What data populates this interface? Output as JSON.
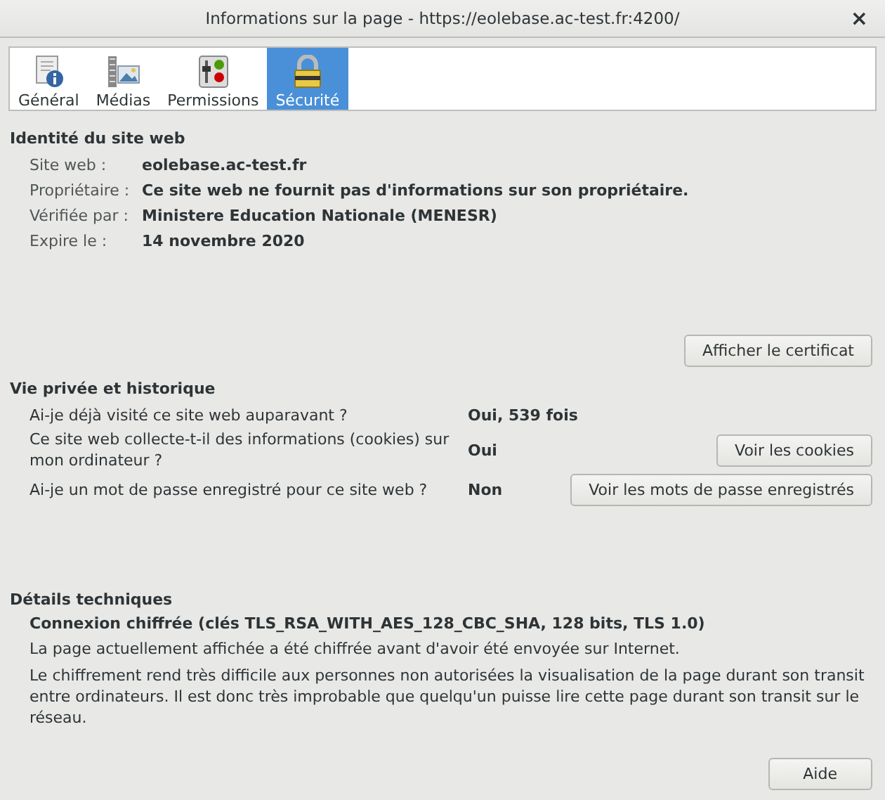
{
  "window": {
    "title": "Informations sur la page - https://eolebase.ac-test.fr:4200/",
    "close": "×"
  },
  "tabs": [
    {
      "label": "Général",
      "kind": "general",
      "selected": false
    },
    {
      "label": "Médias",
      "kind": "media",
      "selected": false
    },
    {
      "label": "Permissions",
      "kind": "permissions",
      "selected": false
    },
    {
      "label": "Sécurité",
      "kind": "security",
      "selected": true
    }
  ],
  "identity": {
    "heading": "Identité du site web",
    "rows": [
      {
        "label": "Site web :",
        "value": "eolebase.ac-test.fr"
      },
      {
        "label": "Propriétaire :",
        "value": "Ce site web ne fournit pas d'informations sur son propriétaire."
      },
      {
        "label": "Vérifiée par :",
        "value": "Ministere Education Nationale (MENESR)"
      },
      {
        "label": "Expire le :",
        "value": "14 novembre 2020"
      }
    ],
    "button": "Afficher le certificat"
  },
  "privacy": {
    "heading": "Vie privée et historique",
    "rows": [
      {
        "question": "Ai-je déjà visité ce site web auparavant ?",
        "answer": "Oui, 539 fois"
      },
      {
        "question": "Ce site web collecte-t-il des informations (cookies) sur mon ordinateur ?",
        "answer": "Oui",
        "button": "Voir les cookies"
      },
      {
        "question": "Ai-je un mot de passe enregistré pour ce site web ?",
        "answer": "Non",
        "button": "Voir les mots de passe enregistrés"
      }
    ]
  },
  "technical": {
    "heading": "Détails techniques",
    "summary": "Connexion chiffrée (clés TLS_RSA_WITH_AES_128_CBC_SHA, 128 bits, TLS 1.0)",
    "paragraphs": [
      "La page actuellement affichée a été chiffrée avant d'avoir été envoyée sur Internet.",
      "Le chiffrement rend très difficile aux personnes non autorisées la visualisation de la page durant son transit entre ordinateurs. Il est donc très improbable que quelqu'un puisse lire cette page durant son transit sur le réseau."
    ]
  },
  "help_button": "Aide"
}
